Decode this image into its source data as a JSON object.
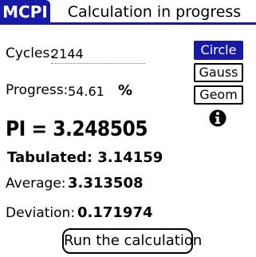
{
  "app": {
    "name": "MCPI",
    "form_title": "Calculation in progress"
  },
  "fields": {
    "cycles_label": "Cycles:",
    "cycles_value": "2144",
    "progress_label": "Progress:",
    "progress_value": "54.61",
    "progress_unit": "%"
  },
  "results": {
    "pi_text": "PI = 3.248505",
    "tabulated_text": "Tabulated: 3.14159",
    "average_label": "Average:",
    "average_value": "3.313508",
    "deviation_label": "Deviation:",
    "deviation_value": "0.171974"
  },
  "methods": [
    {
      "label": "Circle",
      "selected": true
    },
    {
      "label": "Gauss",
      "selected": false
    },
    {
      "label": "Geom",
      "selected": false
    }
  ],
  "info_icon": "info-icon",
  "run_button_label": "Run the calculation",
  "colors": {
    "accent": "#1919a8",
    "background": "#ffffff",
    "text": "#000000"
  }
}
